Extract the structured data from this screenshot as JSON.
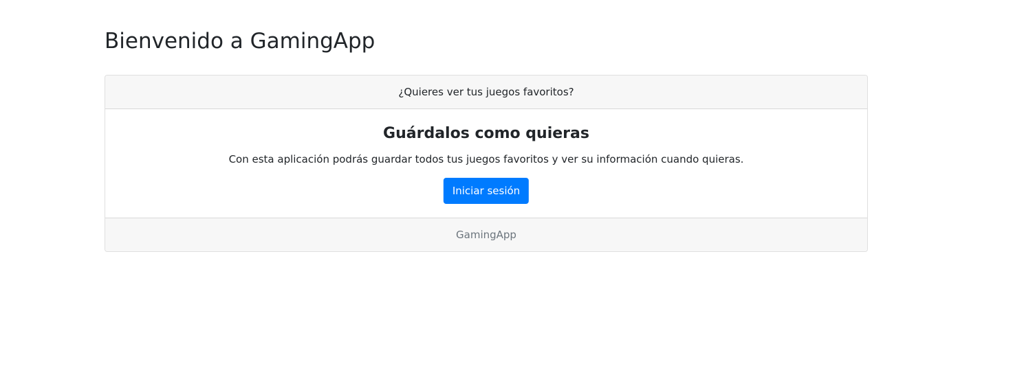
{
  "page": {
    "title": "Bienvenido a GamingApp"
  },
  "card": {
    "header": "¿Quieres ver tus juegos favoritos?",
    "title": "Guárdalos como quieras",
    "text": "Con esta aplicación podrás guardar todos tus juegos favoritos y ver su información cuando quieras.",
    "button_label": "Iniciar sesión",
    "footer": "GamingApp"
  },
  "colors": {
    "primary": "#007bff",
    "header_bg": "#f7f7f7",
    "text": "#212529",
    "muted": "#6c757d"
  }
}
